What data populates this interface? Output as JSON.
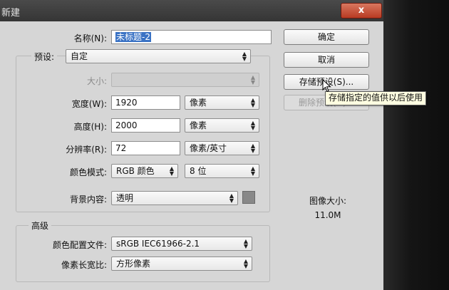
{
  "window": {
    "title": "新建",
    "close_label": "x"
  },
  "form": {
    "name": {
      "label": "名称(N):",
      "value": "未标题-2"
    },
    "preset": {
      "label": "预设:",
      "value": "自定"
    },
    "size": {
      "label": "大小:",
      "value": ""
    },
    "width": {
      "label": "宽度(W):",
      "value": "1920",
      "unit": "像素"
    },
    "height": {
      "label": "高度(H):",
      "value": "2000",
      "unit": "像素"
    },
    "resolution": {
      "label": "分辨率(R):",
      "value": "72",
      "unit": "像素/英寸"
    },
    "color_mode": {
      "label": "颜色模式:",
      "value": "RGB 颜色",
      "depth": "8 位"
    },
    "background": {
      "label": "背景内容:",
      "value": "透明",
      "swatch_color": "#888888"
    }
  },
  "advanced": {
    "title": "高级",
    "color_profile": {
      "label": "颜色配置文件:",
      "value": "sRGB IEC61966-2.1"
    },
    "pixel_aspect": {
      "label": "像素长宽比:",
      "value": "方形像素"
    }
  },
  "buttons": {
    "ok": "确定",
    "cancel": "取消",
    "save_preset": "存储预设(S)...",
    "delete_preset": "删除预设(D)..."
  },
  "tooltip": "存储指定的值供以后使用",
  "image_size": {
    "label": "图像大小:",
    "value": "11.0M"
  }
}
